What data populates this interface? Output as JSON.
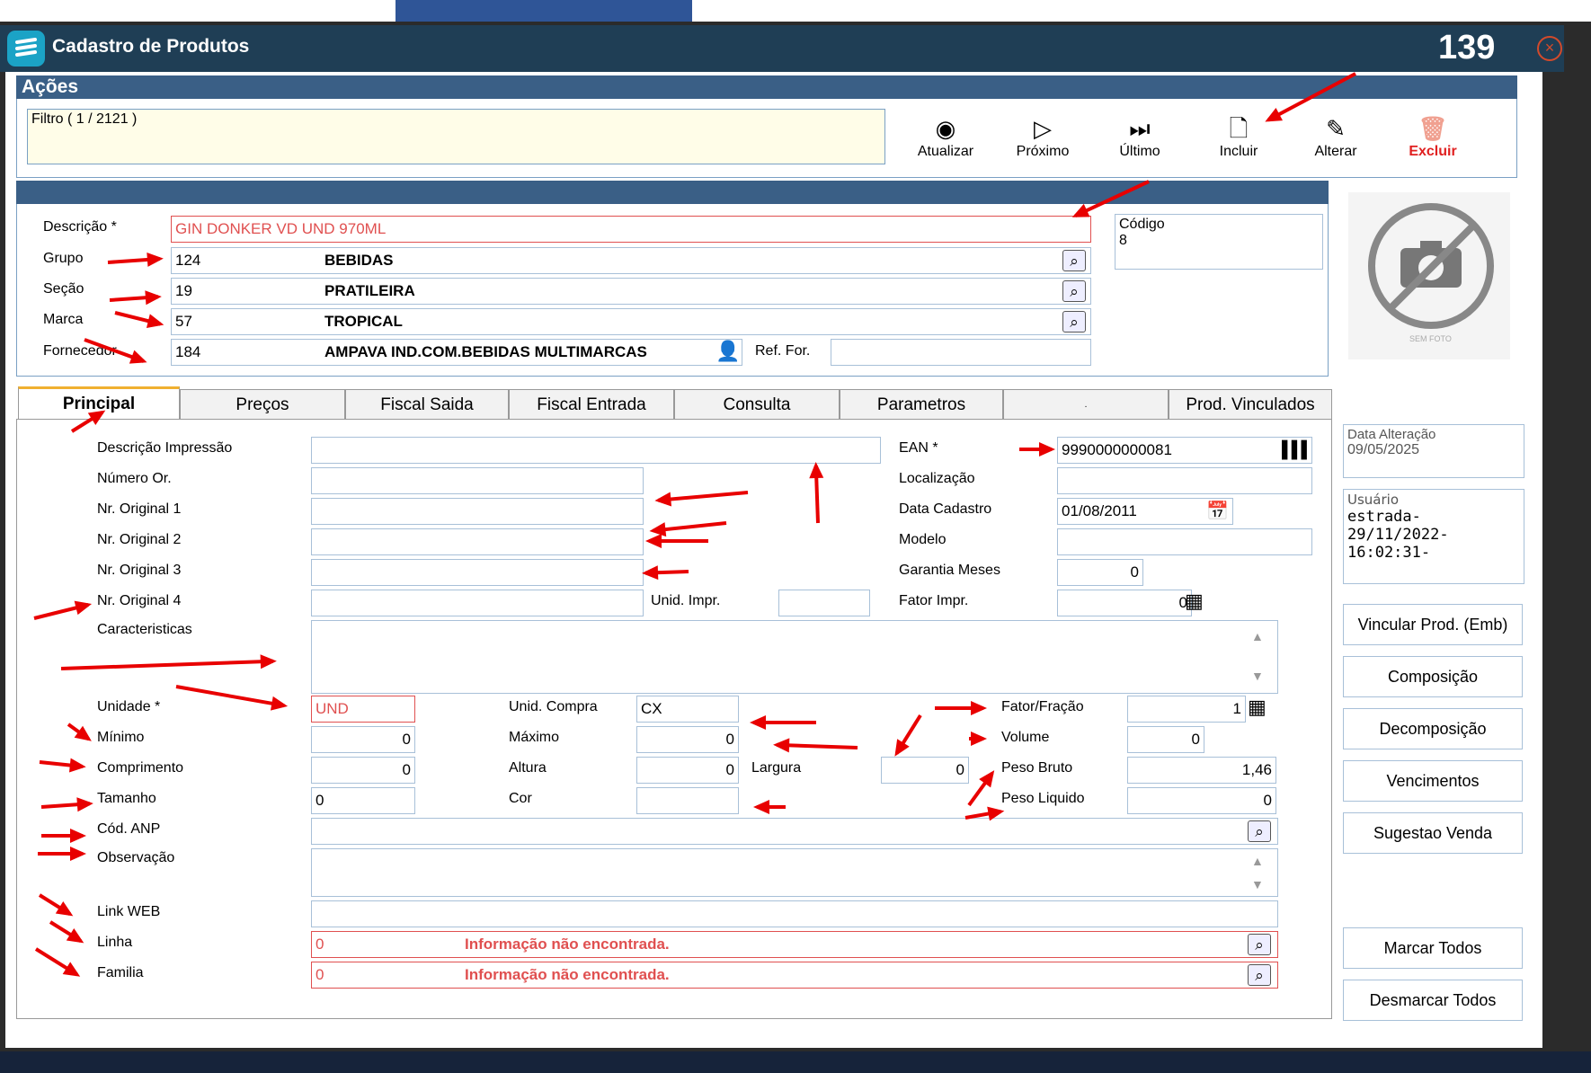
{
  "window": {
    "title": "Cadastro de Produtos",
    "record_count": "139"
  },
  "acoes": {
    "header": "Ações",
    "filtro": "Filtro ( 1 / 2121 )",
    "buttons": {
      "atualizar": "Atualizar",
      "proximo": "Próximo",
      "ultimo": "Último",
      "incluir": "Incluir",
      "alterar": "Alterar",
      "excluir": "Excluir"
    }
  },
  "produto": {
    "descricao_label": "Descrição *",
    "descricao": "GIN DONKER VD UND 970ML",
    "grupo_label": "Grupo",
    "grupo_code": "124",
    "grupo_name": "BEBIDAS",
    "secao_label": "Seção",
    "secao_code": "19",
    "secao_name": "PRATILEIRA",
    "marca_label": "Marca",
    "marca_code": "57",
    "marca_name": "TROPICAL",
    "fornecedor_label": "Fornecedor",
    "fornecedor_code": "184",
    "fornecedor_name": "AMPAVA IND.COM.BEBIDAS MULTIMARCAS",
    "ref_for_label": "Ref. For.",
    "ref_for": "",
    "codigo_label": "Código",
    "codigo": "8",
    "photo_caption": "SEM FOTO"
  },
  "tabs": [
    {
      "label": "Principal"
    },
    {
      "label": "Preços"
    },
    {
      "label": "Fiscal Saida"
    },
    {
      "label": "Fiscal Entrada"
    },
    {
      "label": "Consulta"
    },
    {
      "label": "Parametros"
    },
    {
      "label": "."
    },
    {
      "label": "Prod. Vinculados"
    }
  ],
  "principal": {
    "descricao_impressao_label": "Descrição Impressão",
    "numero_or_label": "Número Or.",
    "nr_original_1_label": "Nr. Original 1",
    "nr_original_2_label": "Nr. Original 2",
    "nr_original_3_label": "Nr. Original 3",
    "nr_original_4_label": "Nr. Original 4",
    "unid_impr_label": "Unid. Impr.",
    "caracteristicas_label": "Caracteristicas",
    "ean_label": "EAN *",
    "ean": "9990000000081",
    "localizacao_label": "Localização",
    "data_cadastro_label": "Data Cadastro",
    "data_cadastro": "01/08/2011",
    "modelo_label": "Modelo",
    "garantia_label": "Garantia Meses",
    "garantia": "0",
    "fator_impr_label": "Fator Impr.",
    "fator_impr": "0",
    "unidade_label": "Unidade *",
    "unidade": "UND",
    "unid_compra_label": "Unid. Compra",
    "unid_compra": "CX",
    "fator_fracao_label": "Fator/Fração",
    "fator_fracao": "1",
    "minimo_label": "Mínimo",
    "minimo": "0",
    "maximo_label": "Máximo",
    "maximo": "0",
    "volume_label": "Volume",
    "volume": "0",
    "comprimento_label": "Comprimento",
    "comprimento": "0",
    "altura_label": "Altura",
    "altura": "0",
    "largura_label": "Largura",
    "largura": "0",
    "peso_bruto_label": "Peso Bruto",
    "peso_bruto": "1,46",
    "tamanho_label": "Tamanho",
    "tamanho": "0",
    "cor_label": "Cor",
    "peso_liquido_label": "Peso Liquido",
    "peso_liquido": "0",
    "cod_anp_label": "Cód. ANP",
    "observacao_label": "Observação",
    "link_web_label": "Link WEB",
    "linha_label": "Linha",
    "linha_code": "0",
    "linha_msg": "Informação não encontrada.",
    "familia_label": "Familia",
    "familia_code": "0",
    "familia_msg": "Informação não encontrada."
  },
  "side": {
    "data_alteracao_label": "Data Alteração",
    "data_alteracao": "09/05/2025",
    "usuario_label": "Usuário",
    "usuario_lines": [
      "estrada-",
      "29/11/2022-",
      "16:02:31-"
    ],
    "buttons": [
      "Vincular Prod. (Emb)",
      "Composição",
      "Decomposição",
      "Vencimentos",
      "Sugestao Venda",
      "Marcar Todos",
      "Desmarcar Todos"
    ]
  },
  "colors": {
    "titlebar": "#1f3e55",
    "section_header": "#3a5f86",
    "required_red": "#e05050",
    "annotation_red": "#e80000",
    "excluir_red": "#e02020"
  }
}
